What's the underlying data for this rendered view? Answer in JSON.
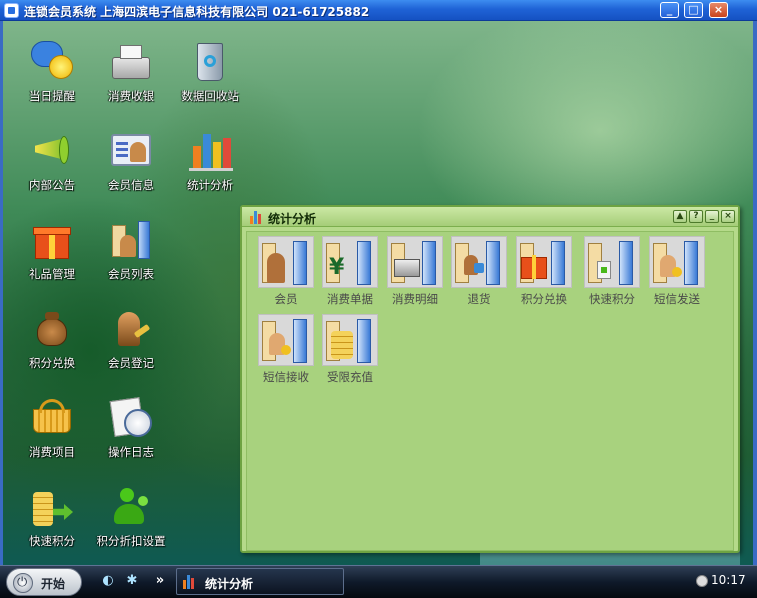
{
  "window": {
    "title": "连锁会员系统  上海四滨电子信息科技有限公司  021-61725882",
    "min_label": "0",
    "max_label": "1",
    "close_label": "r"
  },
  "desktop_icons": [
    {
      "label": "当日提醒",
      "icon": "smiley-bubble-icon"
    },
    {
      "label": "消费收银",
      "icon": "cash-register-icon"
    },
    {
      "label": "数据回收站",
      "icon": "recycle-bin-icon"
    },
    {
      "label": "内部公告",
      "icon": "megaphone-icon"
    },
    {
      "label": "会员信息",
      "icon": "member-card-icon"
    },
    {
      "label": "统计分析",
      "icon": "bar-chart-icon"
    },
    {
      "label": "礼品管理",
      "icon": "gift-box-icon"
    },
    {
      "label": "会员列表",
      "icon": "member-list-icon"
    },
    {
      "label": "积分兑换",
      "icon": "money-bag-icon"
    },
    {
      "label": "会员登记",
      "icon": "member-register-icon"
    },
    {
      "label": "消费项目",
      "icon": "shopping-basket-icon"
    },
    {
      "label": "操作日志",
      "icon": "clock-log-icon"
    },
    {
      "label": "快速积分",
      "icon": "coins-arrow-icon"
    },
    {
      "label": "积分折扣设置",
      "icon": "green-people-icon"
    }
  ],
  "panel": {
    "title": "统计分析",
    "buttons": [
      "▲",
      "?",
      "_",
      "×"
    ],
    "items": [
      {
        "label": "会员",
        "icon": "member-stats-icon"
      },
      {
        "label": "消费单据",
        "icon": "yen-stats-icon"
      },
      {
        "label": "消费明细",
        "icon": "register-stats-icon"
      },
      {
        "label": "退货",
        "icon": "return-stats-icon"
      },
      {
        "label": "积分兑换",
        "icon": "gift-stats-icon"
      },
      {
        "label": "快速积分",
        "icon": "quick-points-stats-icon"
      },
      {
        "label": "短信发送",
        "icon": "sms-send-stats-icon"
      },
      {
        "label": "短信接收",
        "icon": "sms-receive-stats-icon"
      },
      {
        "label": "受限充值",
        "icon": "coins-stats-icon"
      }
    ]
  },
  "taskbar": {
    "start_label": "开始",
    "task_label": "统计分析",
    "chevron": "»",
    "clock": "10:17"
  },
  "colors": {
    "titlebar": "#1f63d6",
    "panel_bg": "#b5da8a",
    "taskbar": "#0f1a2a"
  }
}
